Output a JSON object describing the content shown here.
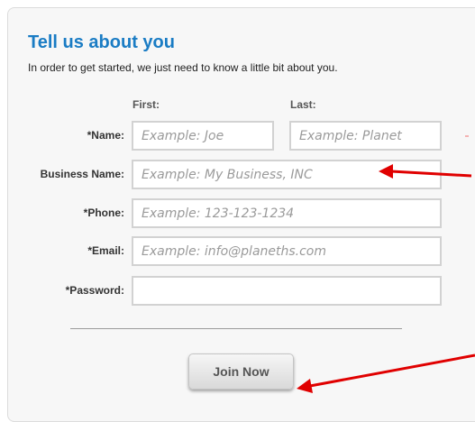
{
  "form": {
    "title": "Tell us about you",
    "subtitle": "In order to get started, we just need to know a little bit about you.",
    "columns": {
      "first": "First:",
      "last": "Last:"
    },
    "name": {
      "label": "*Name:",
      "first_placeholder": "Example: Joe",
      "last_placeholder": "Example: Planet"
    },
    "business": {
      "label": "Business Name:",
      "placeholder": "Example: My Business, INC"
    },
    "phone": {
      "label": "*Phone:",
      "placeholder": "Example: 123-123-1234"
    },
    "email": {
      "label": "*Email:",
      "placeholder": "Example: info@planeths.com"
    },
    "password": {
      "label": "*Password:",
      "value": ""
    },
    "submit_label": "Join Now"
  },
  "colors": {
    "title": "#1a7cc4",
    "annotation_arrow": "#e00000",
    "panel_background": "#f7f7f7",
    "field_border": "#d2d2d2"
  },
  "annotations": [
    {
      "name": "arrow-to-business-name",
      "icon": "red-arrow"
    },
    {
      "name": "arrow-to-join-now",
      "icon": "red-arrow"
    }
  ]
}
